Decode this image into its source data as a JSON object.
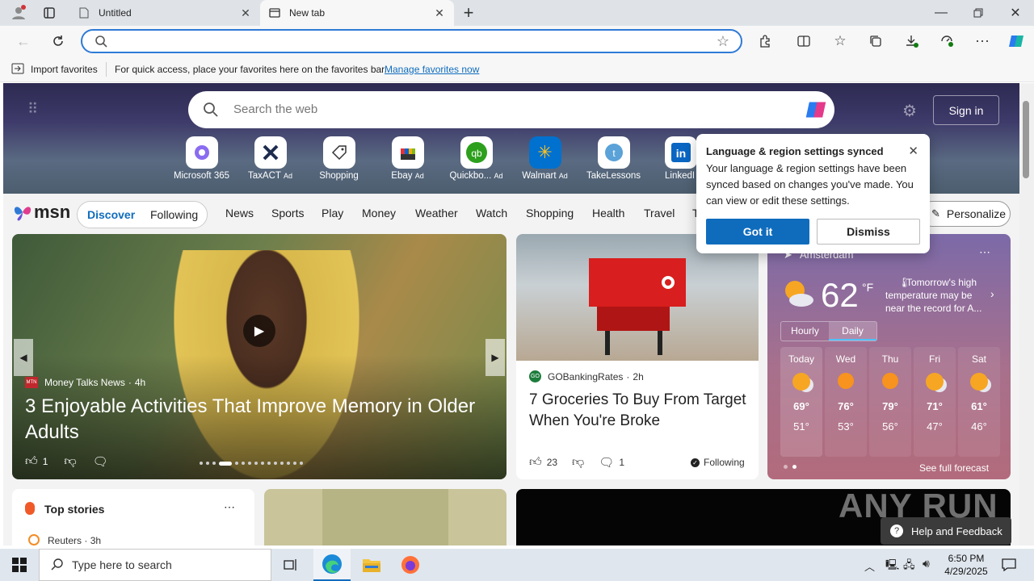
{
  "tabs": [
    {
      "label": "Untitled"
    },
    {
      "label": "New tab"
    }
  ],
  "favorites_bar": {
    "import_label": "Import favorites",
    "hint": "For quick access, place your favorites here on the favorites bar.",
    "manage_link": "Manage favorites now"
  },
  "hero": {
    "search_placeholder": "Search the web",
    "sign_in": "Sign in"
  },
  "quick_links": [
    {
      "label": "Microsoft 365",
      "ad": ""
    },
    {
      "label": "TaxACT",
      "ad": "Ad"
    },
    {
      "label": "Shopping",
      "ad": ""
    },
    {
      "label": "Ebay",
      "ad": "Ad"
    },
    {
      "label": "Quickbo...",
      "ad": "Ad"
    },
    {
      "label": "Walmart",
      "ad": "Ad"
    },
    {
      "label": "TakeLessons",
      "ad": ""
    },
    {
      "label": "LinkedI",
      "ad": ""
    }
  ],
  "msn": {
    "logo": "msn",
    "discover": "Discover",
    "following": "Following",
    "nav": [
      "News",
      "Sports",
      "Play",
      "Money",
      "Weather",
      "Watch",
      "Shopping",
      "Health",
      "Travel",
      "T"
    ],
    "personalize": "Personalize"
  },
  "popup": {
    "title": "Language & region settings synced",
    "body": "Your language & region settings have been synced based on changes you've made. You can view or edit these settings.",
    "got_it": "Got it",
    "dismiss": "Dismiss"
  },
  "main_story": {
    "source": "Money Talks News",
    "age": "4h",
    "title": "3 Enjoyable Activities That Improve Memory in Older Adults",
    "likes": "1"
  },
  "side_story": {
    "source": "GOBankingRates",
    "age": "2h",
    "title": "7 Groceries To Buy From Target When You're Broke",
    "likes": "23",
    "comments": "1",
    "following": "Following"
  },
  "weather": {
    "city": "Amsterdam",
    "temp": "62",
    "unit": "°F",
    "alert": "Tomorrow's high temperature may be near the record for A...",
    "tab_hourly": "Hourly",
    "tab_daily": "Daily",
    "days": [
      {
        "day": "Today",
        "high": "69°",
        "low": "51°"
      },
      {
        "day": "Wed",
        "high": "76°",
        "low": "53°"
      },
      {
        "day": "Thu",
        "high": "79°",
        "low": "56°"
      },
      {
        "day": "Fri",
        "high": "71°",
        "low": "47°"
      },
      {
        "day": "Sat",
        "high": "61°",
        "low": "46°"
      }
    ],
    "see_full": "See full forecast"
  },
  "top_stories": {
    "title": "Top stories",
    "source": "Reuters",
    "age": "3h"
  },
  "help": "Help and Feedback",
  "taskbar": {
    "search_placeholder": "Type here to search",
    "time": "6:50 PM",
    "date": "4/29/2025"
  },
  "watermark": "ANY RUN",
  "colors": {
    "accent": "#0f6cbd",
    "msn_blue": "#0f6cbd",
    "popup_button": "#0f6cbd"
  }
}
